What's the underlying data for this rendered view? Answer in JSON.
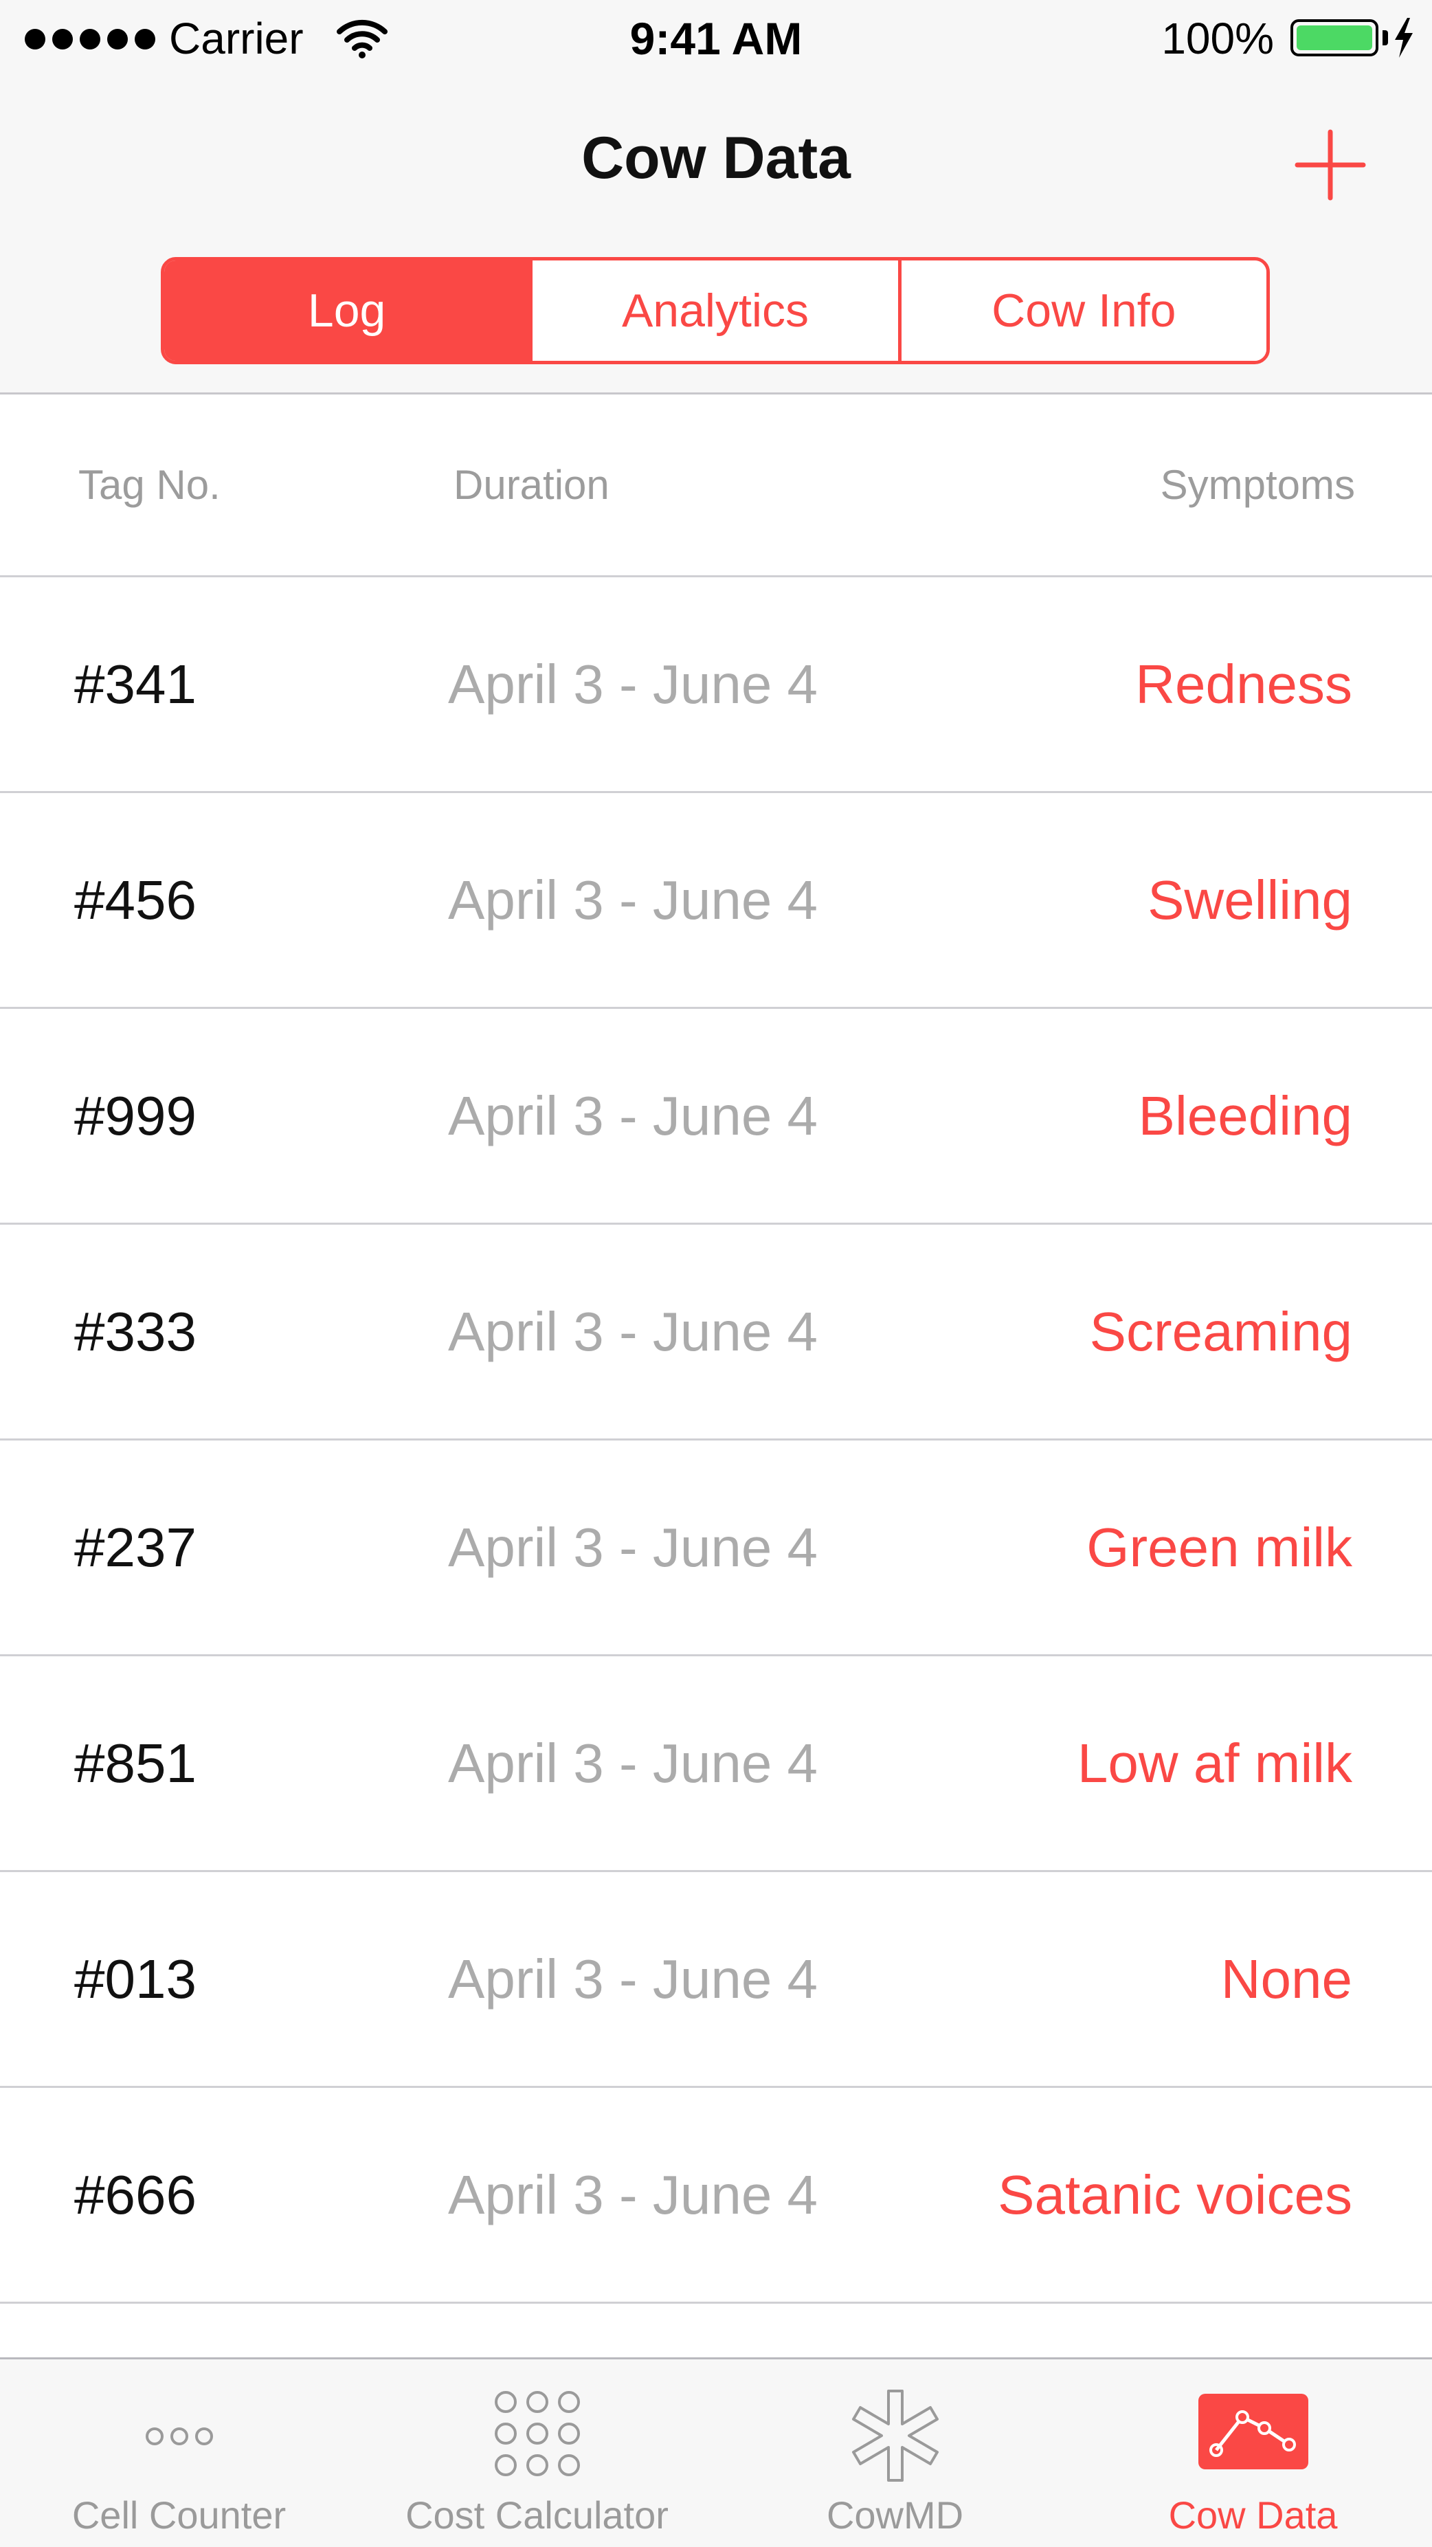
{
  "status_bar": {
    "carrier": "Carrier",
    "time": "9:41 AM",
    "battery_percent": "100%",
    "battery_level": 1.0,
    "battery_color": "#4cd964"
  },
  "nav": {
    "title": "Cow Data",
    "add_icon": "plus-icon"
  },
  "segments": [
    {
      "label": "Log",
      "active": true
    },
    {
      "label": "Analytics",
      "active": false
    },
    {
      "label": "Cow Info",
      "active": false
    }
  ],
  "table": {
    "headers": {
      "tag": "Tag No.",
      "duration": "Duration",
      "symptoms": "Symptoms"
    },
    "rows": [
      {
        "tag": "#341",
        "duration": "April 3 - June 4",
        "symptom": "Redness"
      },
      {
        "tag": "#456",
        "duration": "April 3 - June 4",
        "symptom": "Swelling"
      },
      {
        "tag": "#999",
        "duration": "April 3 - June 4",
        "symptom": "Bleeding"
      },
      {
        "tag": "#333",
        "duration": "April 3 - June 4",
        "symptom": "Screaming"
      },
      {
        "tag": "#237",
        "duration": "April 3 - June 4",
        "symptom": "Green milk"
      },
      {
        "tag": "#851",
        "duration": "April 3 - June 4",
        "symptom": "Low af milk"
      },
      {
        "tag": "#013",
        "duration": "April 3 - June 4",
        "symptom": "None"
      },
      {
        "tag": "#666",
        "duration": "April 3 - June 4",
        "symptom": "Satanic voices"
      }
    ]
  },
  "tab_bar": {
    "tabs": [
      {
        "label": "Cell Counter",
        "icon": "three-dots-icon",
        "active": false
      },
      {
        "label": "Cost Calculator",
        "icon": "nine-dots-grid-icon",
        "active": false
      },
      {
        "label": "CowMD",
        "icon": "medical-asterisk-icon",
        "active": false
      },
      {
        "label": "Cow Data",
        "icon": "line-chart-icon",
        "active": true
      }
    ]
  },
  "colors": {
    "accent": "#fa4845",
    "bar_background": "#f7f7f7",
    "muted_text": "#ababab"
  }
}
